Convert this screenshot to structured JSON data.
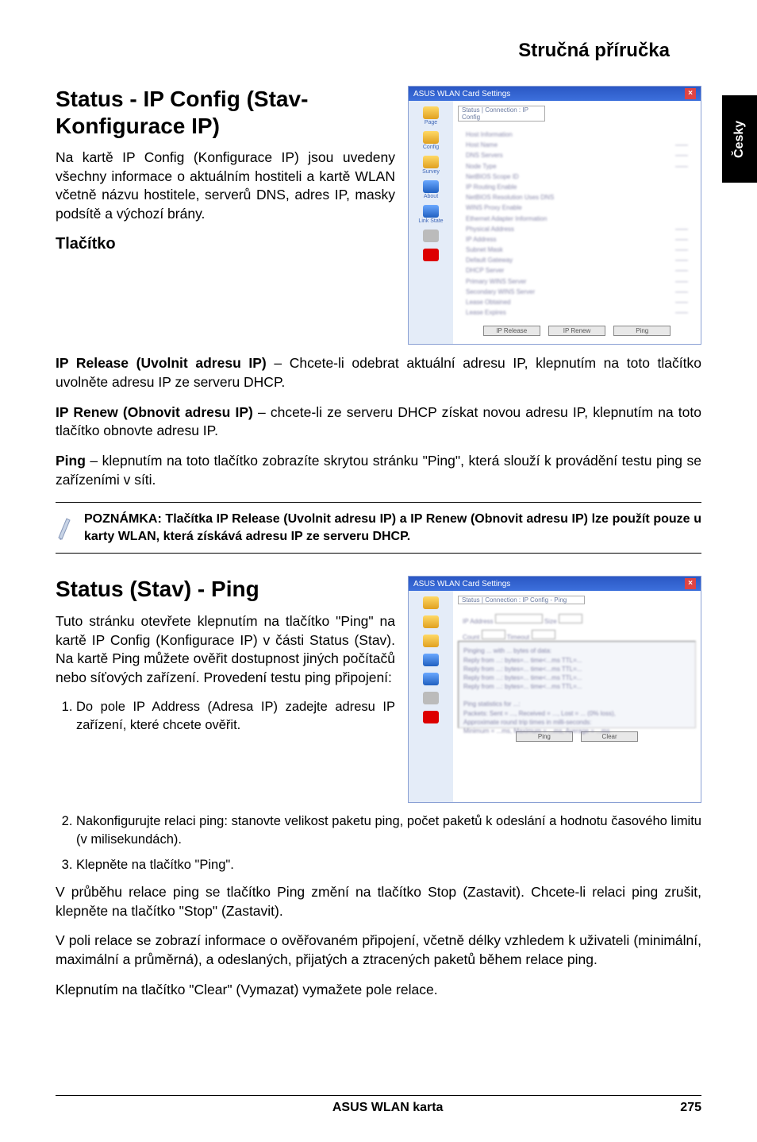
{
  "main_title": "Stručná příručka",
  "side_tab": "Česky",
  "section1": {
    "heading": "Status - IP Config (Stav-Konfigurace IP)",
    "intro": "Na kartě IP Config (Konfigurace IP) jsou uvedeny všechny informace o aktuálním hostiteli a kartě WLAN včetně názvu hostitele, serverů DNS, adres IP, masky podsítě a výchozí brány.",
    "button_heading": "Tlačítko",
    "ip_release_label": "IP Release (Uvolnit adresu IP)",
    "ip_release_text": " – Chcete-li odebrat aktuální adresu IP, klepnutím na toto tlačítko uvolněte adresu IP ze serveru DHCP.",
    "ip_renew_label": "IP Renew (Obnovit adresu IP)",
    "ip_renew_text": " – chcete-li ze serveru DHCP získat novou adresu IP, klepnutím na toto tlačítko obnovte adresu IP.",
    "ping_label": "Ping",
    "ping_text": " – klepnutím na toto tlačítko zobrazíte skrytou stránku \"Ping\", která slouží k provádění testu ping se zařízeními v síti.",
    "note": "POZNÁMKA: Tlačítka IP Release (Uvolnit adresu IP) a IP Renew (Obnovit adresu IP) lze použít pouze u karty WLAN, která získává adresu IP ze serveru DHCP."
  },
  "section2": {
    "heading": "Status (Stav) - Ping",
    "intro": "Tuto stránku otevřete klepnutím na tlačítko \"Ping\" na kartě IP Config (Konfigurace IP) v části Status (Stav). Na kartě Ping můžete ověřit dostupnost jiných počítačů nebo síťových zařízení. Provedení testu ping připojení:",
    "ol1": "Do pole IP Address (Adresa IP) zadejte adresu IP zařízení, které chcete ověřit.",
    "ol2": "Nakonfigurujte relaci ping: stanovte velikost paketu ping, počet paketů k odeslání a hodnotu časového limitu (v milisekundách).",
    "ol3": "Klepněte na tlačítko \"Ping\".",
    "p1": "V průběhu relace ping se tlačítko Ping změní na tlačítko Stop (Zastavit). Chcete-li relaci ping zrušit, klepněte na tlačítko \"Stop\" (Zastavit).",
    "p2": "V poli relace se zobrazí informace o ověřovaném připojení, včetně délky vzhledem k uživateli (minimální, maximální a průměrná), a odeslaných, přijatých a ztracených paketů během relace ping.",
    "p3": "Klepnutím na tlačítko \"Clear\" (Vymazat) vymažete pole relace."
  },
  "screenshot1": {
    "title": "ASUS WLAN Card Settings",
    "tab_page": "Page",
    "tab_config": "Config",
    "tab_survey": "Survey",
    "tab_about": "About",
    "tab_linkstate": "Link State",
    "dropdown": "Status | Connection : IP Config",
    "labels": {
      "host": "Host Information",
      "hostname": "Host Name",
      "dns": "DNS Servers",
      "nodetype": "Node Type",
      "routing": "NetBIOS Scope ID",
      "ipenable": "IP Routing Enable",
      "netbios": "NetBIOS Resolution Uses DNS",
      "wins": "WINS Proxy Enable",
      "ethernet": "Ethernet Adapter Information",
      "physical": "Physical Address",
      "ipaddr": "IP Address",
      "subnet": "Subnet Mask",
      "gateway": "Default Gateway",
      "dhcp": "DHCP Server",
      "pwins": "Primary WINS Server",
      "swins": "Secondary WINS Server",
      "lease1": "Lease Obtained",
      "lease2": "Lease Expires"
    },
    "buttons": {
      "release": "IP Release",
      "renew": "IP Renew",
      "ping": "Ping"
    }
  },
  "screenshot2": {
    "title": "ASUS WLAN Card Settings",
    "dropdown": "Status | Connection : IP Config - Ping",
    "ipaddr": "IP Address",
    "size_label": "Size",
    "count": "Count",
    "timeout": "Timeout",
    "buttons": {
      "ping": "Ping",
      "clear": "Clear"
    }
  },
  "footer": {
    "center": "ASUS WLAN karta",
    "page": "275"
  }
}
